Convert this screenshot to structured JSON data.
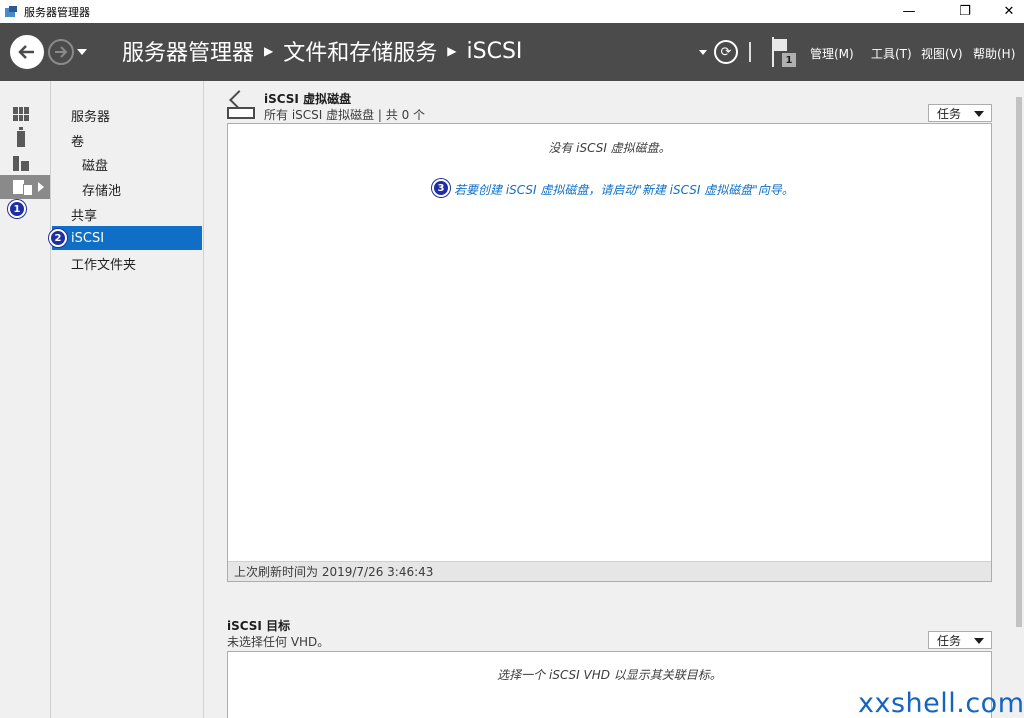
{
  "window": {
    "title": "服务器管理器",
    "controls": {
      "minimize": "—",
      "maximize": "❐",
      "close": "✕"
    }
  },
  "header": {
    "breadcrumb": [
      "服务器管理器",
      "文件和存储服务",
      "iSCSI"
    ],
    "notification_count": "1",
    "menus": [
      "管理(M)",
      "工具(T)",
      "视图(V)",
      "帮助(H)"
    ]
  },
  "rail": {
    "items": [
      {
        "icon": "dashboard-icon"
      },
      {
        "icon": "local-server-icon"
      },
      {
        "icon": "all-servers-icon"
      },
      {
        "icon": "file-storage-icon",
        "active": true
      }
    ],
    "annotation": "1"
  },
  "subnav": {
    "items": [
      {
        "label": "服务器",
        "level": 1
      },
      {
        "label": "卷",
        "level": 1
      },
      {
        "label": "磁盘",
        "level": 2
      },
      {
        "label": "存储池",
        "level": 2
      },
      {
        "label": "共享",
        "level": 1
      },
      {
        "label": "iSCSI",
        "level": 1,
        "active": true
      },
      {
        "label": "工作文件夹",
        "level": 1
      }
    ],
    "annotation": "2"
  },
  "virtual_disks": {
    "title": "iSCSI 虚拟磁盘",
    "subtitle": "所有 iSCSI 虚拟磁盘 | 共 0 个",
    "tasks_label": "任务",
    "empty_message": "没有 iSCSI 虚拟磁盘。",
    "wizard_link": "若要创建 iSCSI 虚拟磁盘，请启动\"新建 iSCSI 虚拟磁盘\"向导。",
    "annotation": "3",
    "last_refresh": "上次刷新时间为 2019/7/26 3:46:43"
  },
  "targets": {
    "title": "iSCSI 目标",
    "subtitle": "未选择任何 VHD。",
    "tasks_label": "任务",
    "empty_message": "选择一个 iSCSI VHD 以显示其关联目标。"
  },
  "watermark": "xxshell.com",
  "colors": {
    "accent": "#0f6fc6",
    "header_bg": "#4b4b4b",
    "badge": "#1f2ea0"
  }
}
